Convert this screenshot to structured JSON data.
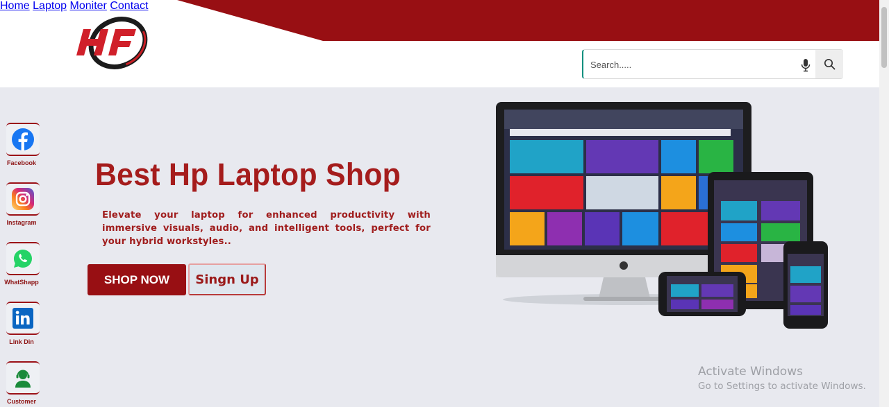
{
  "brand": {
    "logo_text": "HP",
    "accent_color": "#980f13"
  },
  "nav": {
    "items": [
      "Home",
      "Laptop",
      "Moniter",
      "Contact"
    ]
  },
  "search": {
    "placeholder": "Search.....",
    "value": ""
  },
  "social": [
    {
      "label": "Facebook",
      "icon": "facebook-icon"
    },
    {
      "label": "Instagram",
      "icon": "instagram-icon"
    },
    {
      "label": "WhatShapp",
      "icon": "whatsapp-icon"
    },
    {
      "label": "Link Din",
      "icon": "linkedin-icon"
    },
    {
      "label": "Customer",
      "icon": "customer-support-icon"
    }
  ],
  "hero": {
    "title": "Best Hp Laptop Shop",
    "description": "Elevate your laptop for enhanced productivity with immersive visuals, audio, and intelligent tools, perfect for your hybrid workstyles..",
    "shop_button": "SHOP NOW",
    "signup_button": "Singn Up"
  },
  "watermark": {
    "line1": "Activate Windows",
    "line2": "Go to Settings to activate Windows."
  }
}
